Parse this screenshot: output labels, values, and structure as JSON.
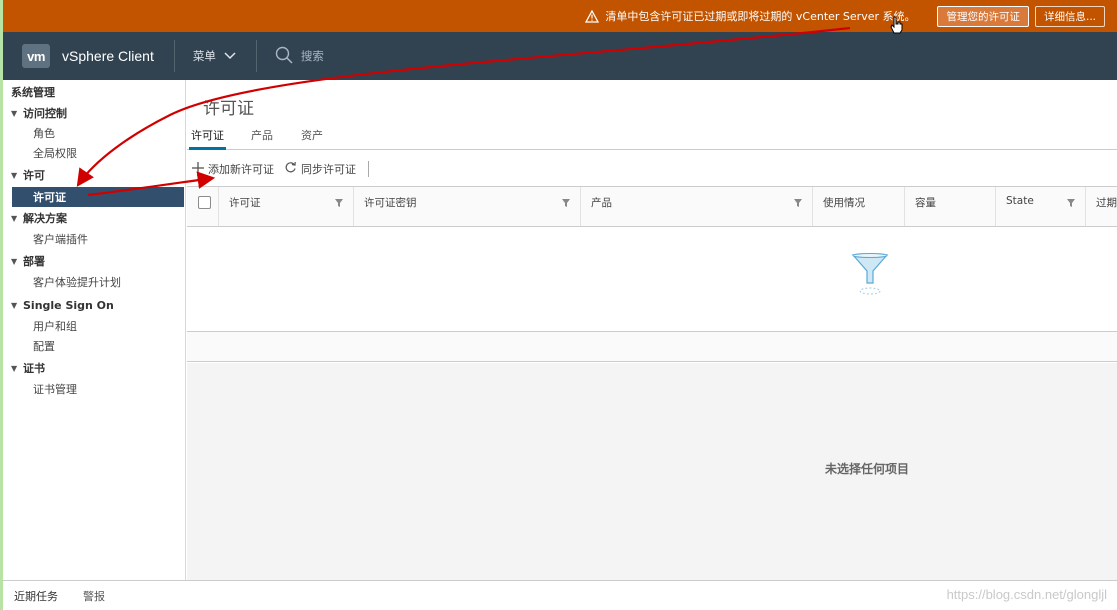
{
  "alert": {
    "message": "清单中包含许可证已过期或即将过期的 vCenter Server 系统。",
    "manage_button": "管理您的许可证",
    "details_button": "详细信息..."
  },
  "header": {
    "logo": "vm",
    "app_name": "vSphere Client",
    "menu_label": "菜单",
    "search_label": "搜索"
  },
  "sidebar": {
    "heading": "系统管理",
    "groups": [
      {
        "label": "访问控制",
        "children": [
          "角色",
          "全局权限"
        ]
      },
      {
        "label": "许可",
        "children": [
          "许可证"
        ]
      },
      {
        "label": "解决方案",
        "children": [
          "客户端插件"
        ]
      },
      {
        "label": "部署",
        "children": [
          "客户体验提升计划"
        ]
      },
      {
        "label": "Single Sign On",
        "children": [
          "用户和组",
          "配置"
        ]
      },
      {
        "label": "证书",
        "children": [
          "证书管理"
        ]
      }
    ],
    "active_item": "许可证"
  },
  "main": {
    "title": "许可证",
    "tabs": [
      "许可证",
      "产品",
      "资产"
    ],
    "active_tab": "许可证",
    "toolbar": {
      "add_label": "添加新许可证",
      "sync_label": "同步许可证"
    },
    "columns": [
      "许可证",
      "许可证密钥",
      "产品",
      "使用情况",
      "容量",
      "State",
      "过期"
    ],
    "empty_detail": "未选择任何项目"
  },
  "bottom": {
    "tasks_tab": "近期任务",
    "alarms_tab": "警报"
  },
  "watermark": "https://blog.csdn.net/glongljl",
  "colors": {
    "alert_bg": "#c25400",
    "header_bg": "#314351",
    "active_nav_bg": "#324f6e",
    "tab_underline": "#0072a3",
    "annotation_arrow": "#d10000"
  }
}
